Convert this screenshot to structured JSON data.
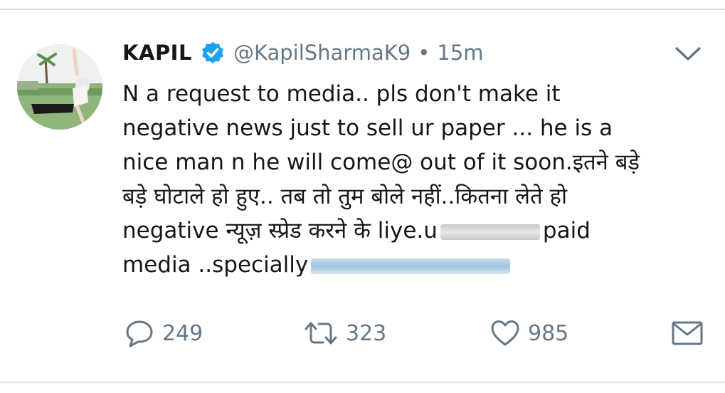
{
  "tweet": {
    "name": "KAPIL",
    "handle": "@KapilSharmaK9",
    "separator": "•",
    "time": "15m",
    "lines": [
      "N a request to media.. pls don't make it",
      "negative news just to sell ur paper ... he is a",
      "nice man n he will come@ out of it soon.इतने बड़े",
      "बड़े घोटाले हो हुए.. तब तो तुम बोले नहीं..कितना लेते हो",
      "negative न्यूज़ स्प्रेड करने के liye.u",
      "paid",
      "media ..specially"
    ]
  },
  "actions": {
    "reply_count": "249",
    "retweet_count": "323",
    "like_count": "985"
  },
  "icons": {
    "verified": "verified-badge-icon",
    "menu": "chevron-down-icon",
    "reply": "reply-icon",
    "retweet": "retweet-icon",
    "like": "heart-icon",
    "dm": "envelope-icon"
  },
  "colors": {
    "verified": "#1da1f2",
    "secondary_text": "#657786",
    "primary_text": "#14171a"
  }
}
